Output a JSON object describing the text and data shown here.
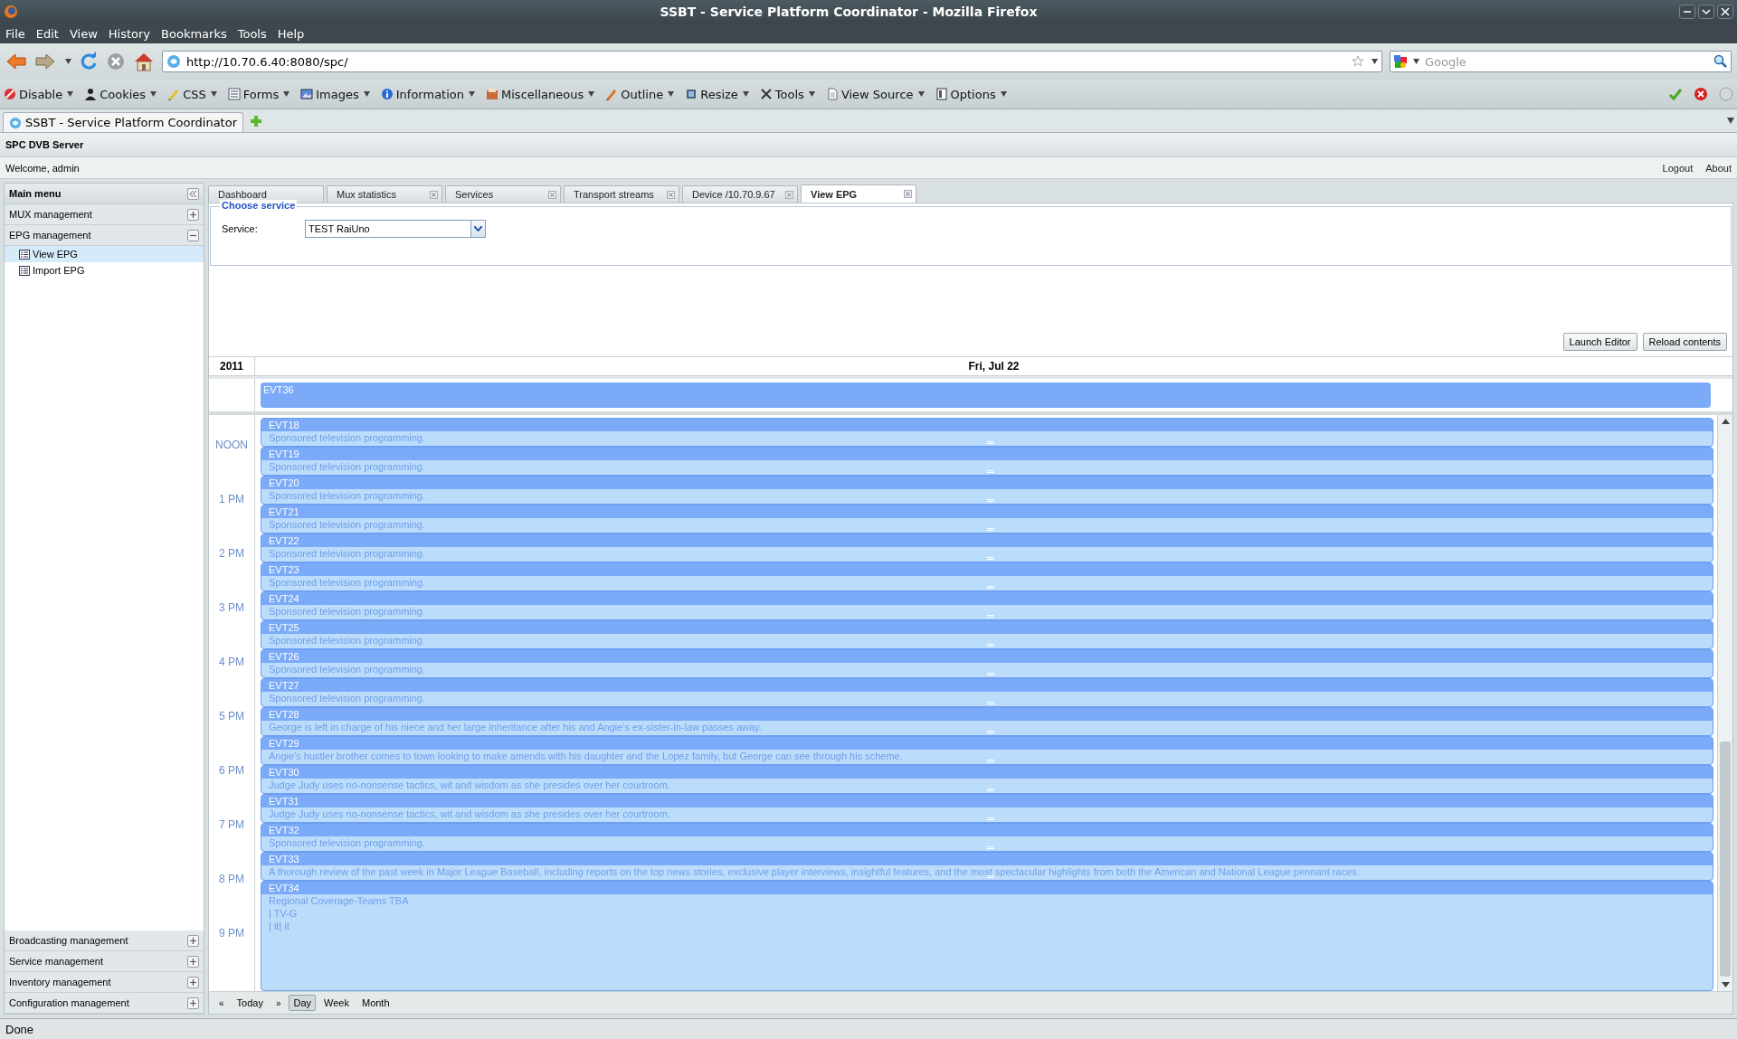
{
  "window": {
    "title": "SSBT - Service Platform Coordinator - Mozilla Firefox"
  },
  "menu": [
    "File",
    "Edit",
    "View",
    "History",
    "Bookmarks",
    "Tools",
    "Help"
  ],
  "nav": {
    "url": "http://10.70.6.40:8080/spc/",
    "search_placeholder": "Google"
  },
  "toolbar": [
    "Disable",
    "Cookies",
    "CSS",
    "Forms",
    "Images",
    "Information",
    "Miscellaneous",
    "Outline",
    "Resize",
    "Tools",
    "View Source",
    "Options"
  ],
  "browser_tab": "SSBT - Service Platform Coordinator",
  "app": {
    "title": "SPC DVB Server",
    "welcome": "Welcome, admin",
    "links": [
      "Logout",
      "About"
    ]
  },
  "sidebar": {
    "title": "Main menu",
    "sections": [
      {
        "label": "MUX management",
        "expanded": false
      },
      {
        "label": "EPG management",
        "expanded": true,
        "children": [
          {
            "label": "View EPG",
            "selected": true
          },
          {
            "label": "Import EPG",
            "selected": false
          }
        ]
      }
    ],
    "bottom_sections": [
      {
        "label": "Broadcasting management",
        "expanded": false
      },
      {
        "label": "Service management",
        "expanded": false
      },
      {
        "label": "Inventory management",
        "expanded": false
      },
      {
        "label": "Configuration management",
        "expanded": false
      }
    ]
  },
  "tabs": [
    {
      "label": "Dashboard",
      "selected": false,
      "closable": false
    },
    {
      "label": "Mux statistics",
      "selected": false,
      "closable": true
    },
    {
      "label": "Services",
      "selected": false,
      "closable": true
    },
    {
      "label": "Transport streams",
      "selected": false,
      "closable": true
    },
    {
      "label": "Device /10.70.9.67",
      "selected": false,
      "closable": true
    },
    {
      "label": "View EPG",
      "selected": true,
      "closable": true
    }
  ],
  "choose_service": {
    "legend": "Choose service",
    "label": "Service:",
    "value": "TEST RaiUno"
  },
  "buttons": [
    "Launch Editor",
    "Reload contents"
  ],
  "calendar": {
    "year": "2011",
    "date": "Fri, Jul 22",
    "all_day": [
      "EVT36"
    ],
    "hours": [
      "NOON",
      "1 PM",
      "2 PM",
      "3 PM",
      "4 PM",
      "5 PM",
      "6 PM",
      "7 PM",
      "8 PM",
      "9 PM"
    ],
    "events": [
      {
        "name": "EVT18",
        "lines": [
          "Sponsored television programming."
        ]
      },
      {
        "name": "EVT19",
        "lines": [
          "Sponsored television programming."
        ]
      },
      {
        "name": "EVT20",
        "lines": [
          "Sponsored television programming."
        ]
      },
      {
        "name": "EVT21",
        "lines": [
          "Sponsored television programming."
        ]
      },
      {
        "name": "EVT22",
        "lines": [
          "Sponsored television programming."
        ]
      },
      {
        "name": "EVT23",
        "lines": [
          "Sponsored television programming."
        ]
      },
      {
        "name": "EVT24",
        "lines": [
          "Sponsored television programming."
        ]
      },
      {
        "name": "EVT25",
        "lines": [
          "Sponsored television programming."
        ]
      },
      {
        "name": "EVT26",
        "lines": [
          "Sponsored television programming."
        ]
      },
      {
        "name": "EVT27",
        "lines": [
          "Sponsored television programming."
        ]
      },
      {
        "name": "EVT28",
        "lines": [
          "George is left in charge of his niece and her large inheritance after his and Angie's ex-sister-in-law passes away."
        ]
      },
      {
        "name": "EVT29",
        "lines": [
          "Angie's hustler brother comes to town looking to make amends with his daughter and the Lopez family, but George can see through his scheme."
        ]
      },
      {
        "name": "EVT30",
        "lines": [
          "Judge Judy uses no-nonsense tactics, wit and wisdom as she presides over her courtroom."
        ]
      },
      {
        "name": "EVT31",
        "lines": [
          "Judge Judy uses no-nonsense tactics, wit and wisdom as she presides over her courtroom."
        ]
      },
      {
        "name": "EVT32",
        "lines": [
          "Sponsored television programming."
        ]
      },
      {
        "name": "EVT33",
        "lines": [
          "A thorough review of the past week in Major League Baseball, including reports on the top news stories, exclusive player interviews, insightful features, and the most spectacular highlights from both the American and National League pennant races."
        ]
      },
      {
        "name": "EVT34",
        "lines": [
          "Regional Coverage-Teams TBA",
          "| TV-G",
          "| it| it"
        ]
      }
    ],
    "nav": {
      "prev": "«",
      "today": "Today",
      "next": "»",
      "views": [
        {
          "label": "Day",
          "selected": true
        },
        {
          "label": "Week",
          "selected": false
        },
        {
          "label": "Month",
          "selected": false
        }
      ]
    }
  },
  "status": "Done"
}
